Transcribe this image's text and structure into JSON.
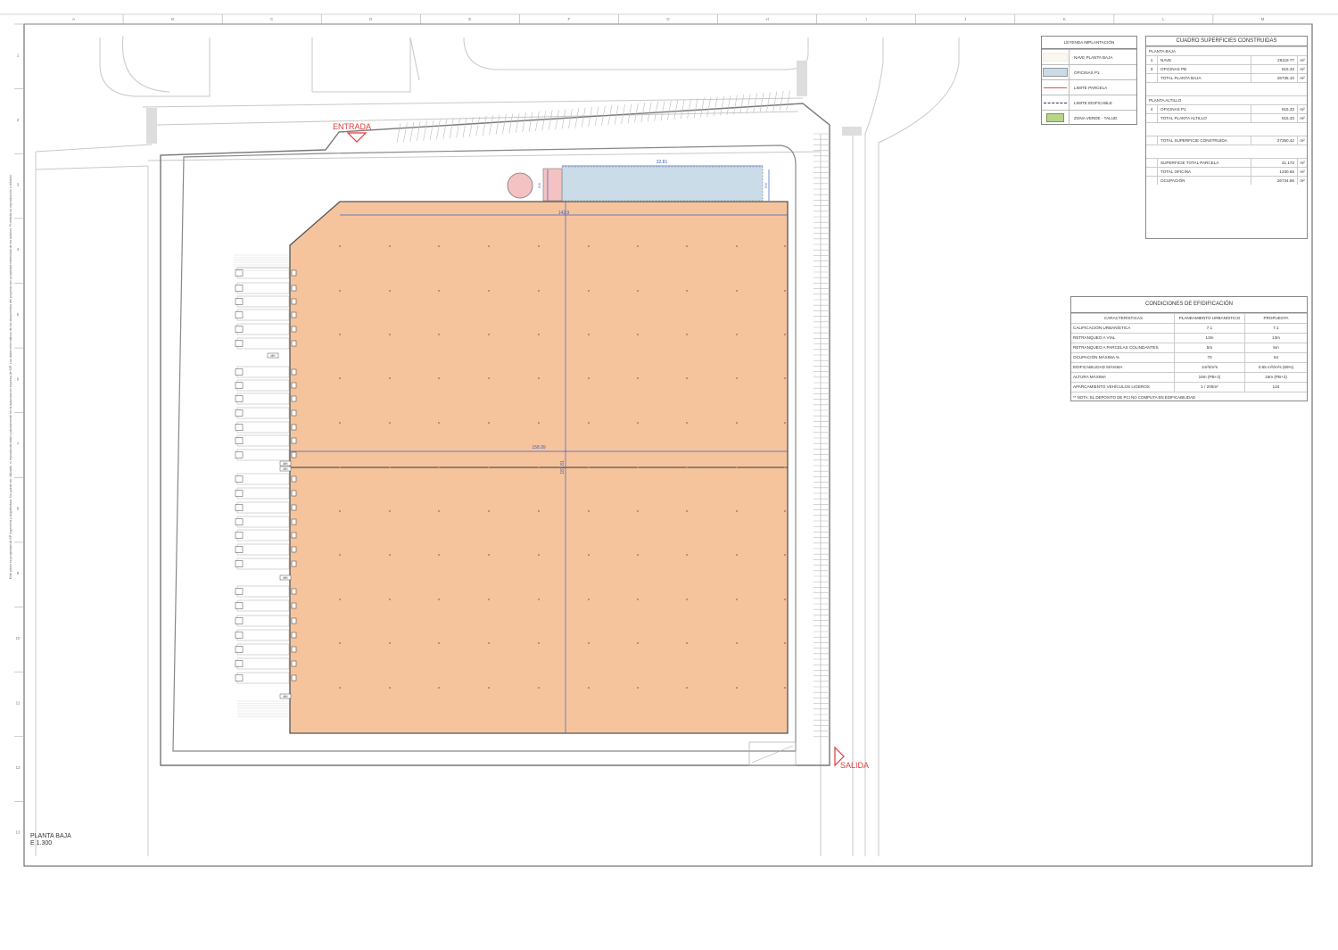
{
  "grid": {
    "columns": [
      "A",
      "B",
      "C",
      "D",
      "E",
      "F",
      "G",
      "H",
      "I",
      "J",
      "K",
      "L",
      "M"
    ],
    "rows": [
      "1",
      "2",
      "3",
      "4",
      "5",
      "6",
      "7",
      "8",
      "9",
      "10",
      "11",
      "12",
      "13"
    ]
  },
  "labels": {
    "entrada": "ENTRADA",
    "salida": "SALIDA",
    "dim_office_width": "32.81",
    "dim_office_depth_left": "8.8",
    "dim_office_depth_right": "6.6",
    "dim_top_width": "142.9",
    "dim_mid_width": "158.99",
    "dim_height": "187.81",
    "dock_tag": "MH"
  },
  "plan_title": {
    "line1": "PLANTA BAJA",
    "line2": "E 1.300"
  },
  "side_note": "Este plano es propiedad de KP Ingeniería y Arquitectura. No puede ser utilizado, ni reproducido total o parcialmente sin la autorización expresa de KIP. Los datos informativos de los documentos del proyecto son propiedad intelectual de los autores. Prohibida su reproducción o difusión.",
  "colors": {
    "nave": "#f6c49c",
    "nave_stroke": "#555555",
    "oficinas": "#c9dce8",
    "oficinas_pb": "#f4c2c2",
    "limite_parcela": "#d9534f",
    "limite_edificable": "#333366",
    "zona_verde": "#b7d68a",
    "dim_blue": "#3a5ec8",
    "red_label": "#e23a3a"
  },
  "legend": {
    "title": "LEYENDA IMPLANTACIÓN",
    "items": [
      {
        "label": "NAVE PLANTA BAJA",
        "swatch": "nave-baja"
      },
      {
        "label": "OFICINAS P1",
        "swatch": "oficinas"
      },
      {
        "label": "LIMITE PARCELA",
        "swatch": "red-line"
      },
      {
        "label": "LIMITE EDIFICABLE",
        "swatch": "dash-line"
      },
      {
        "label": "ZONA VERDE - TALUD",
        "swatch": "green"
      }
    ]
  },
  "superficies": {
    "title": "CUADRO SUPERFICIES CONSTRUIDAS",
    "rows": [
      {
        "a": "",
        "b": "PLANTA BAJA",
        "c": "",
        "d": ""
      },
      {
        "a": "1",
        "b": "NAVE",
        "c": "26119.77",
        "d": "m²"
      },
      {
        "a": "3",
        "b": "OFICINAS PB",
        "c": "615.33",
        "d": "m²"
      },
      {
        "a": "",
        "b": "TOTAL PLANTA BAJA",
        "c": "26735.10",
        "d": "m²"
      },
      {
        "a": "",
        "b": "",
        "c": "",
        "d": "",
        "gap": true
      },
      {
        "a": "",
        "b": "PLANTA ALTILLO",
        "c": "",
        "d": ""
      },
      {
        "a": "4",
        "b": "OFICINAS P1",
        "c": "615.33",
        "d": "m²"
      },
      {
        "a": "",
        "b": "TOTAL PLANTA ALTILLO",
        "c": "615.33",
        "d": "m²"
      },
      {
        "a": "",
        "b": "",
        "c": "",
        "d": "",
        "gap": true
      },
      {
        "a": "",
        "b": "TOTAL SUPERFICIE CONSTRUIDA",
        "c": "27350.42",
        "d": "m²"
      },
      {
        "a": "",
        "b": "",
        "c": "",
        "d": "",
        "gap": true
      },
      {
        "a": "",
        "b": "SUPERFICIE TOTAL PARCELA",
        "c": "41.173",
        "d": "m²"
      },
      {
        "a": "",
        "b": "TOTAL OFICINA",
        "c": "1230.65",
        "d": "m²"
      },
      {
        "a": "",
        "b": "OCUPACIÓN",
        "c": "26734.66",
        "d": "m²"
      }
    ]
  },
  "condiciones": {
    "title": "CONDICIONES DE EFIDIFICACIÓN",
    "headers": [
      "CARACTERÍSTICAS",
      "PLANEAMIENTO URBANÍSTICO",
      "PROPUESTA"
    ],
    "rows": [
      [
        "CALIFICACIÓN URBANÍSTICA",
        "7.1",
        "7.1"
      ],
      [
        "RETRANQUEO A VIAL",
        "13m",
        "13m"
      ],
      [
        "RETRANQUEO A PARCELAS COLINDANTES",
        "5m",
        "5m"
      ],
      [
        "OCUPACIÓN MÁXIMA %",
        "70",
        "64"
      ],
      [
        "EDIFICABILIDAD MÁXIMA",
        "1m²t/m²s",
        "0.65 m²t/m²s (65%)"
      ],
      [
        "ALTURA MÁXIMA",
        "16m (PB+2)",
        "16m (PB+2)"
      ],
      [
        "APARCAMIENTO VEHÍCULOS LIGEROS",
        "1 / 200m²",
        "124"
      ]
    ],
    "note": "** NOTA: EL DEPOSITO DE PCI NO COMPUTA EN EDIFICABILIDAD"
  }
}
